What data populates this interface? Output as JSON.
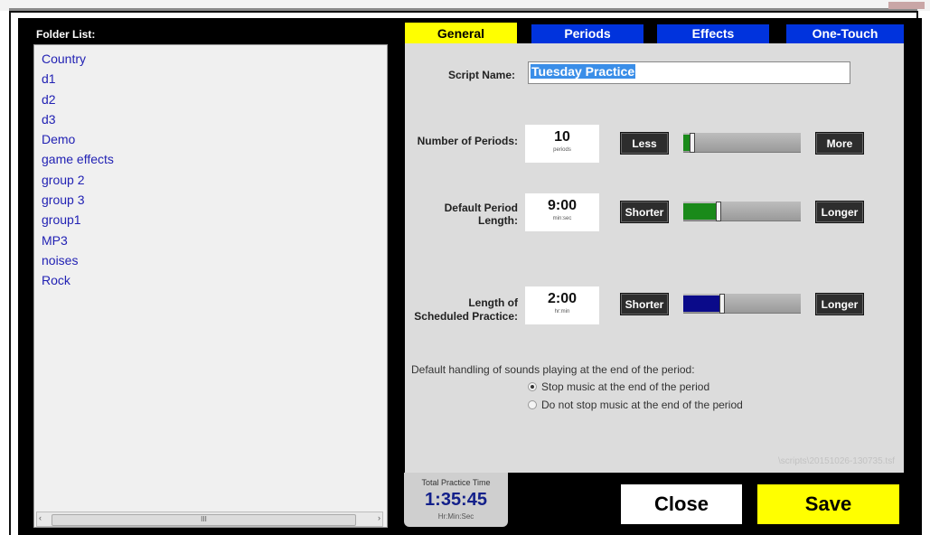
{
  "folder_list": {
    "title": "Folder List:",
    "items": [
      "Country",
      "d1",
      "d2",
      "d3",
      "Demo",
      "game effects",
      "group 2",
      "group 3",
      "group1",
      "MP3",
      "noises",
      "Rock"
    ],
    "scrollbar": {
      "left_arrow": "‹",
      "right_arrow": "›",
      "thumb_grip": "III"
    }
  },
  "tabs": [
    {
      "label": "General",
      "active": true
    },
    {
      "label": "Periods",
      "active": false
    },
    {
      "label": "Effects",
      "active": false
    },
    {
      "label": "One-Touch",
      "active": false
    }
  ],
  "general": {
    "script_name_label": "Script Name:",
    "script_name_value": "Tuesday Practice",
    "periods": {
      "label": "Number of Periods:",
      "value": "10",
      "unit": "periods",
      "decrease_label": "Less",
      "increase_label": "More",
      "slider_level": 0.08,
      "slider_color": "#1a8a1a"
    },
    "period_length": {
      "label": "Default Period Length:",
      "value": "9:00",
      "unit": "min:sec",
      "decrease_label": "Shorter",
      "increase_label": "Longer",
      "slider_level": 0.3,
      "slider_color": "#1a8a1a"
    },
    "scheduled_practice": {
      "label_line1": "Length of",
      "label_line2": "Scheduled Practice:",
      "value": "2:00",
      "unit": "hr:min",
      "decrease_label": "Shorter",
      "increase_label": "Longer",
      "slider_level": 0.33,
      "slider_color": "#0a0a8a"
    },
    "default_handling_label": "Default handling of sounds playing at the end of the period:",
    "radio_options": [
      {
        "label": "Stop music at the end of the period",
        "selected": true
      },
      {
        "label": "Do not stop music at the end of the period",
        "selected": false
      }
    ],
    "script_path": "\\scripts\\20151026-130735.tsf"
  },
  "total_practice": {
    "label": "Total Practice Time",
    "value": "1:35:45",
    "unit": "Hr:Min:Sec"
  },
  "actions": {
    "close_label": "Close",
    "save_label": "Save"
  },
  "colors": {
    "active_tab": "#ffff00",
    "inactive_tab": "#0033dd",
    "folder_text": "#2222b4",
    "save_button": "#ffff00",
    "total_time_text": "#13208a"
  }
}
